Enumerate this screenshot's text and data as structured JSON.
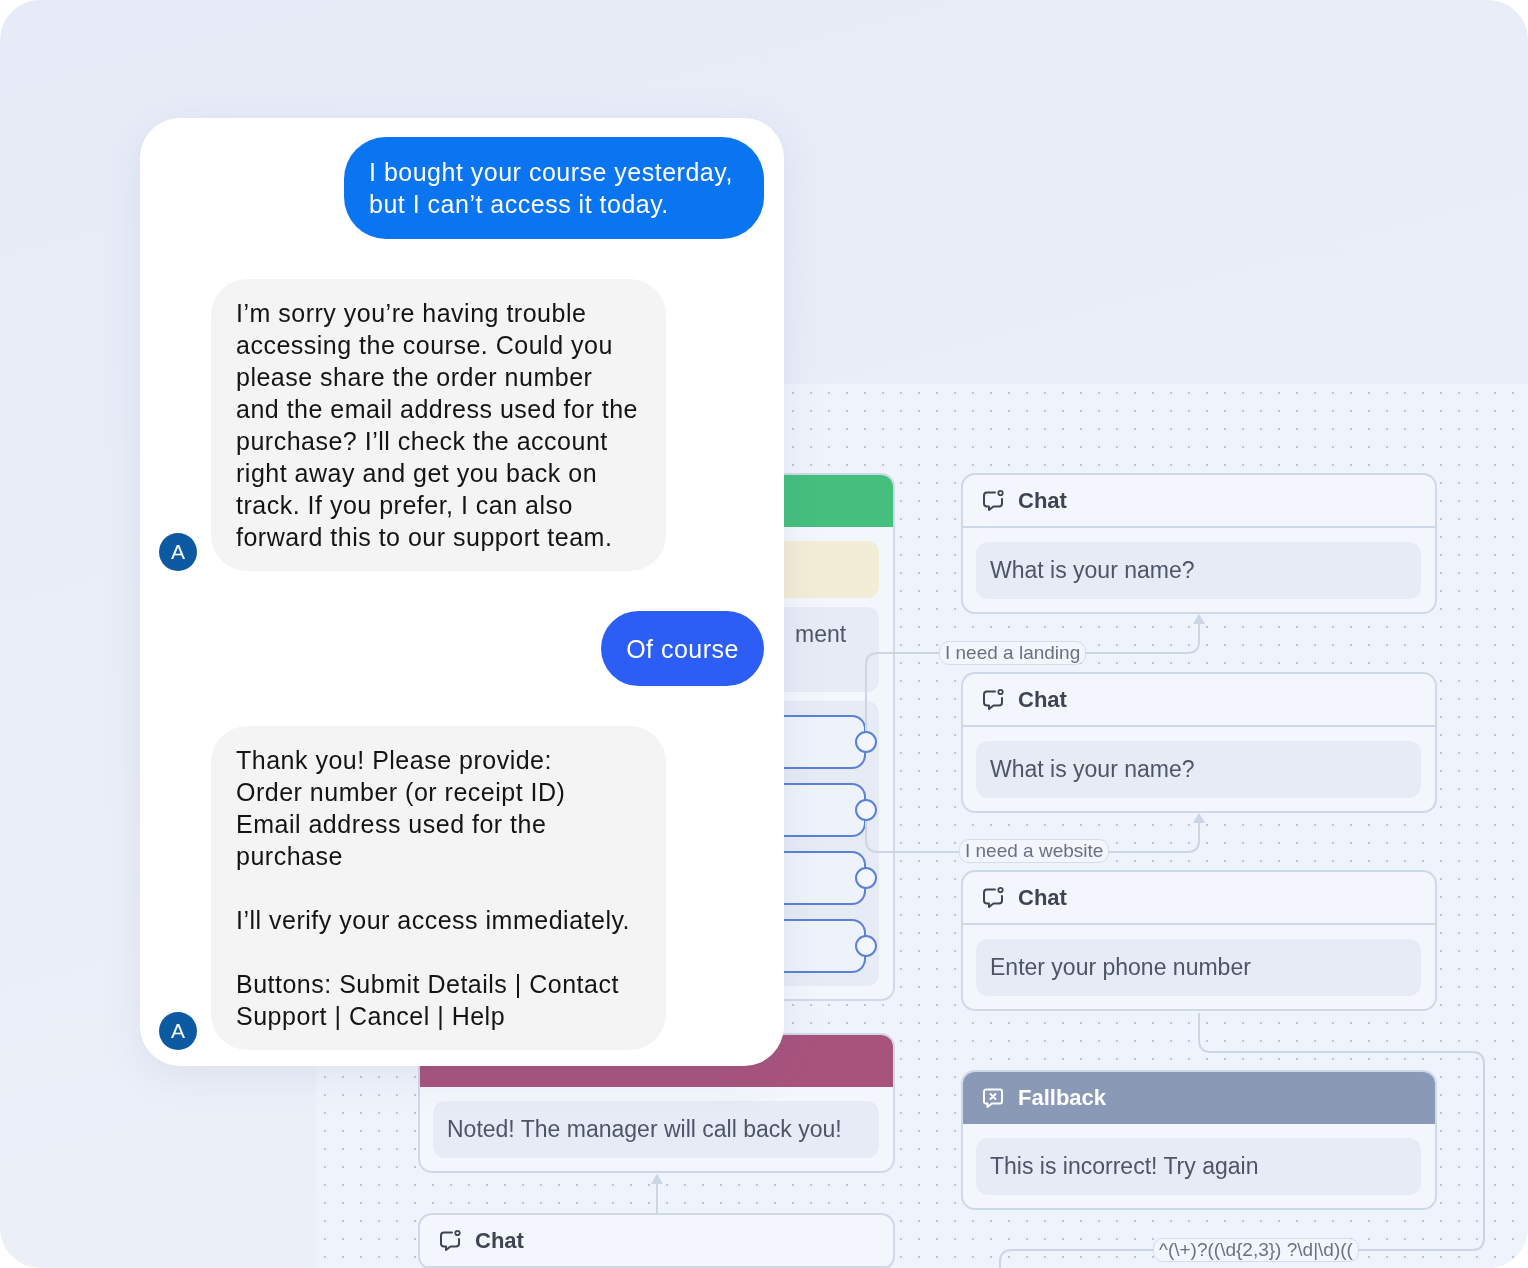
{
  "chat": {
    "messages": [
      {
        "kind": "user",
        "color": "#0a74f1",
        "text": "I bought your course yesterday, but I can’t access it today."
      },
      {
        "kind": "bot",
        "avatar": "A",
        "text": "I’m sorry you’re having trouble accessing the course. Could you please share the order number and the email address used for the purchase? I’ll check the account right away and get you back on track. If you prefer, I can also forward this to our support team."
      },
      {
        "kind": "user",
        "color": "#2c5ef5",
        "text": "Of course"
      },
      {
        "kind": "bot",
        "avatar": "A",
        "text": "Thank you! Please provide:\nOrder number (or receipt ID)\nEmail address used for the purchase\n\nI’ll verify your access immediately.\n\nButtons: Submit Details | Contact Support | Cancel | Help"
      }
    ]
  },
  "flow": {
    "nodes": [
      {
        "kind": "banner",
        "color": "#44bf7e",
        "blocks": [
          {
            "kind": "note"
          },
          {
            "kind": "text",
            "text": "ment"
          },
          {
            "kind": "options",
            "options": [
              {
                "kind": "pill"
              },
              {
                "kind": "pill"
              },
              {
                "kind": "pill"
              },
              {
                "kind": "pill"
              }
            ]
          }
        ]
      },
      {
        "kind": "chat",
        "title": "Chat",
        "blocks": [
          {
            "kind": "text",
            "text": "What is your name?"
          }
        ]
      },
      {
        "kind": "chat",
        "title": "Chat",
        "blocks": [
          {
            "kind": "text",
            "text": "What is your name?"
          }
        ]
      },
      {
        "kind": "chat",
        "title": "Chat",
        "blocks": [
          {
            "kind": "text",
            "text": "Enter your phone number"
          }
        ]
      },
      {
        "kind": "banner",
        "color": "#a8537c",
        "blocks": [
          {
            "kind": "text",
            "text": "Noted! The manager will call back you!"
          }
        ]
      },
      {
        "kind": "fallback",
        "title": "Fallback",
        "color": "#8a9ab6",
        "blocks": [
          {
            "kind": "text",
            "text": "This is incorrect! Try again"
          }
        ]
      },
      {
        "kind": "chat",
        "title": "Chat"
      }
    ],
    "edges": [
      {
        "label": "I need a landing"
      },
      {
        "label": "I need a website"
      },
      {
        "label": "^(\\+)?((\\d{2,3}) ?\\d|\\d)(("
      }
    ]
  }
}
